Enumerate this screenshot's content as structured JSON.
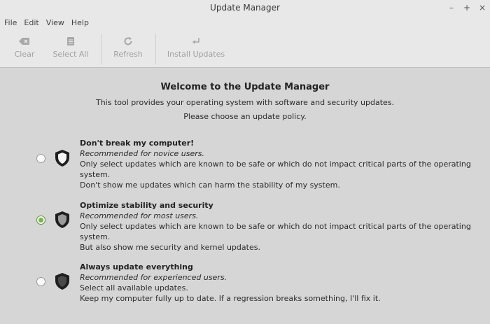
{
  "window": {
    "title": "Update Manager",
    "minimize_glyph": "–",
    "maximize_glyph": "+",
    "close_glyph": "×"
  },
  "menu": [
    "File",
    "Edit",
    "View",
    "Help"
  ],
  "toolbar": {
    "clear_label": "Clear",
    "select_all_label": "Select All",
    "refresh_label": "Refresh",
    "install_label": "Install Updates"
  },
  "welcome": {
    "heading": "Welcome to the Update Manager",
    "line1": "This tool provides your operating system with software and security updates.",
    "line2": "Please choose an update policy."
  },
  "options": [
    {
      "title": "Don't break my computer!",
      "recommend": "Recommended for novice users.",
      "desc1": "Only select updates which are known to be safe or which do not impact critical parts of the operating system.",
      "desc2": "Don't show me updates which can harm the stability of my system.",
      "selected": false
    },
    {
      "title": "Optimize stability and security",
      "recommend": "Recommended for most users.",
      "desc1": "Only select updates which are known to be safe or which do not impact critical parts of the operating system.",
      "desc2": "But also show me security and kernel updates.",
      "selected": true
    },
    {
      "title": "Always update everything",
      "recommend": "Recommended for experienced users.",
      "desc1": "Select all available updates.",
      "desc2": "Keep my computer fully up to date. If a regression breaks something, I'll fix it.",
      "selected": false
    }
  ],
  "colors": {
    "radio_selected": "#7cb342",
    "background": "#d6d6d6",
    "toolbar": "#e8e8e8"
  }
}
